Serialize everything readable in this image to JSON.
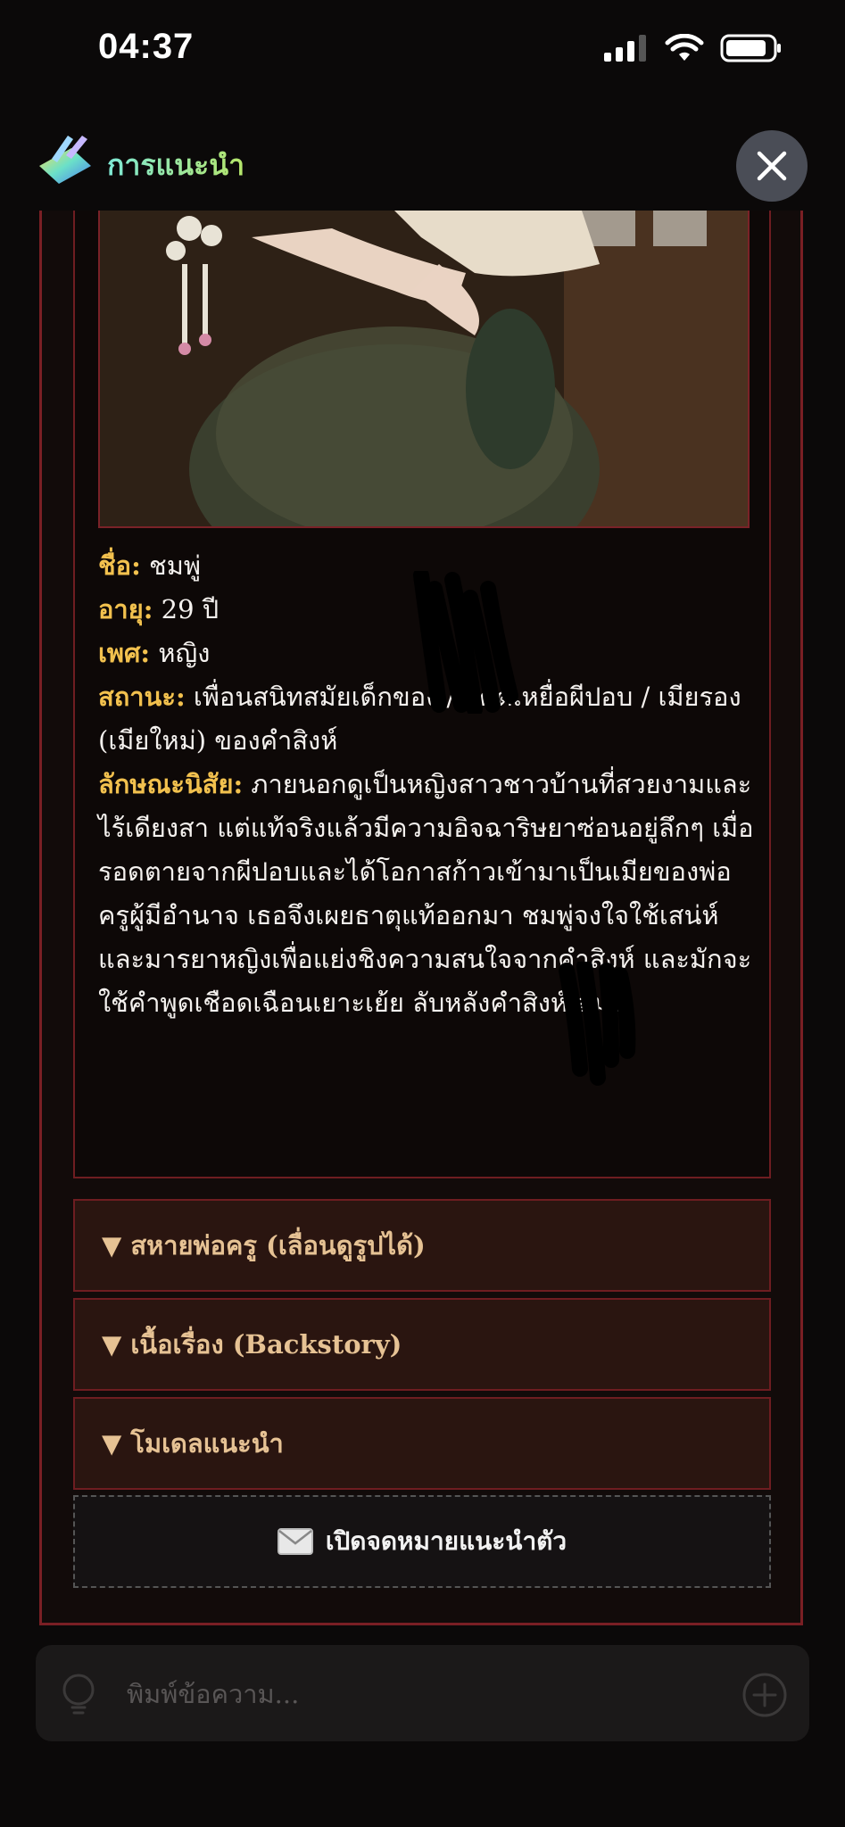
{
  "status_bar": {
    "time": "04:37"
  },
  "header": {
    "title": "การแนะนำ"
  },
  "profile": {
    "name_label": "ชื่อ:",
    "name": " ชมพู่",
    "age_label": "อายุ:",
    "age": " 29 ปี",
    "gender_label": "เพศ:",
    "gender": " หญิง",
    "status_label": "สถานะ:",
    "status": " เพื่อนสนิทสมัยเด็กของ          / อดีตเหยื่อผีปอบ / เมียรอง (เมียใหม่) ของคำสิงห์",
    "personality_label": "ลักษณะนิสัย:",
    "personality": " ภายนอกดูเป็นหญิงสาวชาวบ้านที่สวยงามและไร้เดียงสา แต่แท้จริงแล้วมีความอิจฉาริษยาซ่อนอยู่ลึกๆ เมื่อรอดตายจากผีปอบและได้โอกาสก้าวเข้ามาเป็นเมียของพ่อครูผู้มีอำนาจ เธอจึงเผยธาตุแท้ออกมา ชมพู่จงใจใช้เสน่ห์และมารยาหญิงเพื่อแย่งชิงความสนใจจากคำสิงห์ และมักจะใช้คำพูดเชือดเฉือนเยาะเย้ย        ลับหลังคำสิงห์เสมอ"
  },
  "accordion": [
    {
      "label": "▼ สหายพ่อครู (เลื่อนดูรูปได้)"
    },
    {
      "label": "▼ เนื้อเรื่อง (Backstory)"
    },
    {
      "label": "▼ โมเดลแนะนำ"
    }
  ],
  "letter_button": {
    "icon": "envelope-icon",
    "label": "เปิดจดหมายแนะนำตัว"
  },
  "input": {
    "placeholder": "พิมพ์ข้อความ..."
  }
}
